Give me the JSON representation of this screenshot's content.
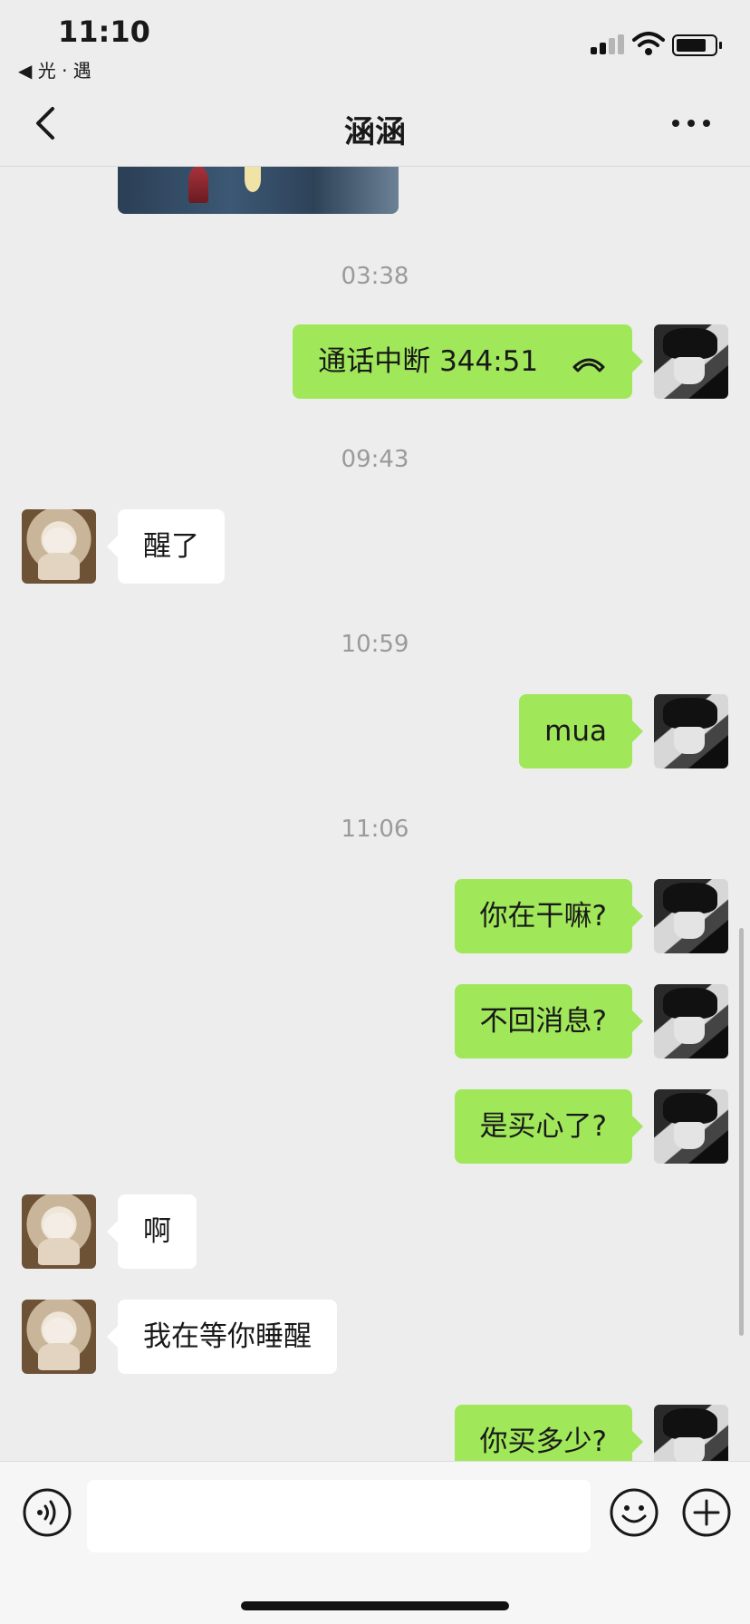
{
  "status_bar": {
    "time": "11:10",
    "back_app": "◀ 光 · 遇"
  },
  "nav": {
    "title": "涵涵"
  },
  "messages": [
    {
      "kind": "timestamp",
      "text": "03:38"
    },
    {
      "kind": "sent",
      "text": "通话中断 344:51",
      "icon": "phone-hangup-icon"
    },
    {
      "kind": "timestamp",
      "text": "09:43"
    },
    {
      "kind": "received",
      "text": "醒了"
    },
    {
      "kind": "timestamp",
      "text": "10:59"
    },
    {
      "kind": "sent",
      "text": "mua"
    },
    {
      "kind": "timestamp",
      "text": "11:06"
    },
    {
      "kind": "sent",
      "text": "你在干嘛?"
    },
    {
      "kind": "sent",
      "text": "不回消息?"
    },
    {
      "kind": "sent",
      "text": "是买心了?"
    },
    {
      "kind": "received",
      "text": "啊"
    },
    {
      "kind": "received",
      "text": "我在等你睡醒"
    },
    {
      "kind": "sent",
      "text": "你买多少?"
    }
  ],
  "input": {
    "value": "",
    "placeholder": ""
  },
  "colors": {
    "background": "#ededed",
    "sent_bubble": "#a0e75a",
    "received_bubble": "#ffffff",
    "timestamp": "#9a9a9a"
  },
  "icons": {
    "back": "chevron-left-icon",
    "more": "more-dots-icon",
    "voice": "voice-input-icon",
    "emoji": "emoji-icon",
    "plus": "plus-icon"
  }
}
